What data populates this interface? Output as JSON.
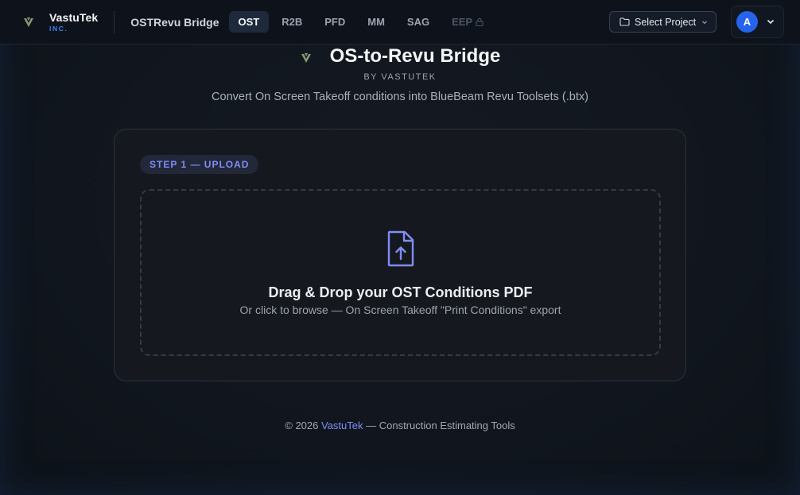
{
  "header": {
    "brand_name": "VastuTek",
    "brand_inc": "INC.",
    "app_title": "OSTRevu Bridge",
    "tabs": [
      {
        "label": "OST",
        "state": "active"
      },
      {
        "label": "R2B",
        "state": "normal"
      },
      {
        "label": "PFD",
        "state": "normal"
      },
      {
        "label": "MM",
        "state": "normal"
      },
      {
        "label": "SAG",
        "state": "normal"
      },
      {
        "label": "EEP",
        "state": "locked"
      }
    ],
    "select_project_label": "Select Project",
    "user_initial": "A"
  },
  "hero": {
    "title": "OS-to-Revu Bridge",
    "by_line": "BY VASTUTEK",
    "subtitle": "Convert On Screen Takeoff conditions into BlueBeam Revu Toolsets (.btx)"
  },
  "upload": {
    "step_badge": "STEP 1 — UPLOAD",
    "drop_title": "Drag & Drop your OST Conditions PDF",
    "drop_subtitle": "Or click to browse — On Screen Takeoff \"Print Conditions\" export"
  },
  "footer": {
    "prefix": "© 2026 ",
    "link": "VastuTek",
    "suffix": " — Construction Estimating Tools"
  },
  "colors": {
    "accent_blue": "#3b82f6",
    "accent_indigo": "#818cf8",
    "avatar_bg": "#2563eb",
    "background": "#10151d"
  },
  "icons": {
    "brand": "vastutek-logo-icon",
    "hero": "vastutek-logo-icon",
    "lock": "lock-icon",
    "folder": "folder-icon",
    "chevron": "chevron-down-icon",
    "upload": "file-upload-icon"
  }
}
